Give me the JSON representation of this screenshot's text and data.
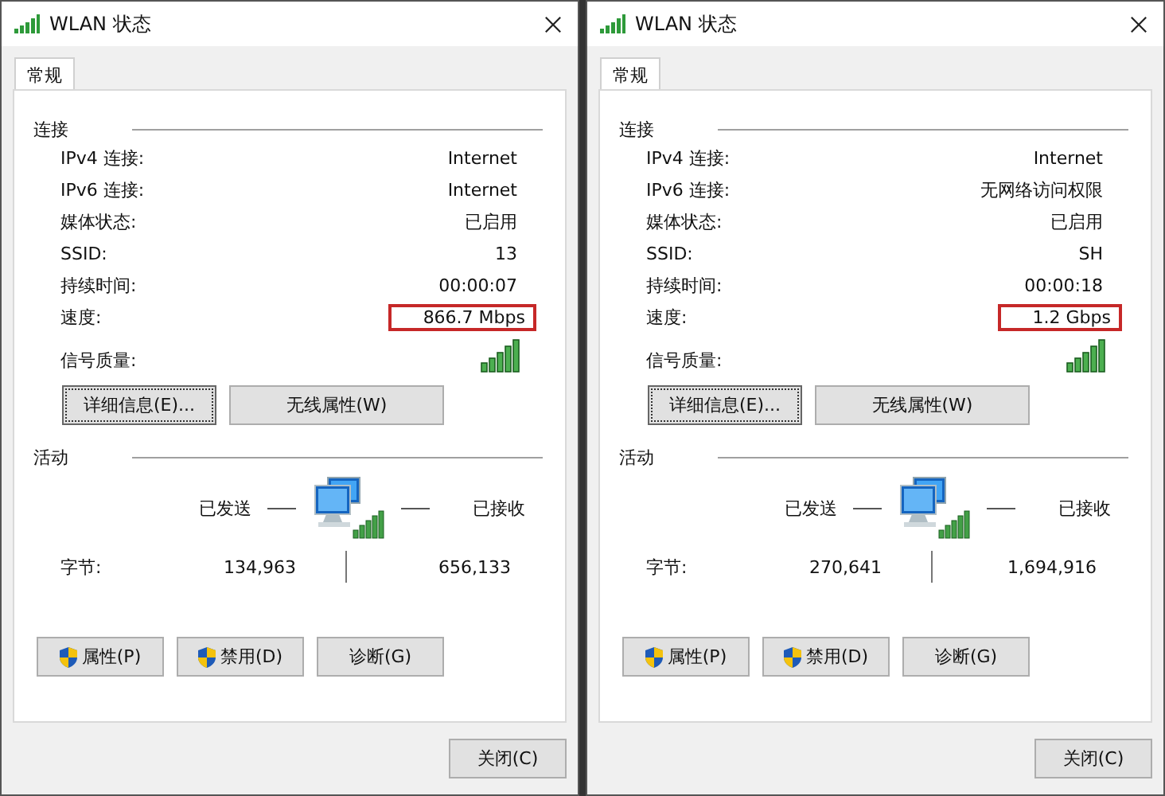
{
  "dialogs": [
    {
      "title": "WLAN 状态",
      "tabs": [
        {
          "label": "常规",
          "selected": true
        }
      ],
      "connection": {
        "heading": "连接",
        "rows": [
          {
            "kind": "text",
            "label": "IPv4 连接:",
            "value": "Internet",
            "highlighted": false
          },
          {
            "kind": "text",
            "label": "IPv6 连接:",
            "value": "Internet",
            "highlighted": false
          },
          {
            "kind": "text",
            "label": "媒体状态:",
            "value": "已启用",
            "highlighted": false
          },
          {
            "kind": "text",
            "label": "SSID:",
            "value": "13",
            "highlighted": false
          },
          {
            "kind": "text",
            "label": "持续时间:",
            "value": "00:00:07",
            "highlighted": false
          },
          {
            "kind": "text",
            "label": "速度:",
            "value": "866.7 Mbps",
            "highlighted": true
          },
          {
            "kind": "signal",
            "label": "信号质量:"
          }
        ]
      },
      "buttons": [
        {
          "label": "详细信息(E)...",
          "focused": true
        },
        {
          "label": "无线属性(W)",
          "focused": false
        }
      ],
      "activity": {
        "heading": "活动",
        "sent_label": "已发送",
        "received_label": "已接收",
        "bytes_label": "字节:",
        "bytes_sent": "134,963",
        "bytes_received": "656,133"
      },
      "action_buttons": [
        {
          "label": "属性(P)",
          "shield": true
        },
        {
          "label": "禁用(D)",
          "shield": true
        },
        {
          "label": "诊断(G)",
          "shield": false
        }
      ],
      "close_button": "关闭(C)"
    },
    {
      "title": "WLAN 状态",
      "tabs": [
        {
          "label": "常规",
          "selected": true
        }
      ],
      "connection": {
        "heading": "连接",
        "rows": [
          {
            "kind": "text",
            "label": "IPv4 连接:",
            "value": "Internet",
            "highlighted": false
          },
          {
            "kind": "text",
            "label": "IPv6 连接:",
            "value": "无网络访问权限",
            "highlighted": false
          },
          {
            "kind": "text",
            "label": "媒体状态:",
            "value": "已启用",
            "highlighted": false
          },
          {
            "kind": "text",
            "label": "SSID:",
            "value": "SH",
            "highlighted": false
          },
          {
            "kind": "text",
            "label": "持续时间:",
            "value": "00:00:18",
            "highlighted": false
          },
          {
            "kind": "text",
            "label": "速度:",
            "value": "1.2 Gbps",
            "highlighted": true
          },
          {
            "kind": "signal",
            "label": "信号质量:"
          }
        ]
      },
      "buttons": [
        {
          "label": "详细信息(E)...",
          "focused": true
        },
        {
          "label": "无线属性(W)",
          "focused": false
        }
      ],
      "activity": {
        "heading": "活动",
        "sent_label": "已发送",
        "received_label": "已接收",
        "bytes_label": "字节:",
        "bytes_sent": "270,641",
        "bytes_received": "1,694,916"
      },
      "action_buttons": [
        {
          "label": "属性(P)",
          "shield": true
        },
        {
          "label": "禁用(D)",
          "shield": true
        },
        {
          "label": "诊断(G)",
          "shield": false
        }
      ],
      "close_button": "关闭(C)"
    }
  ]
}
